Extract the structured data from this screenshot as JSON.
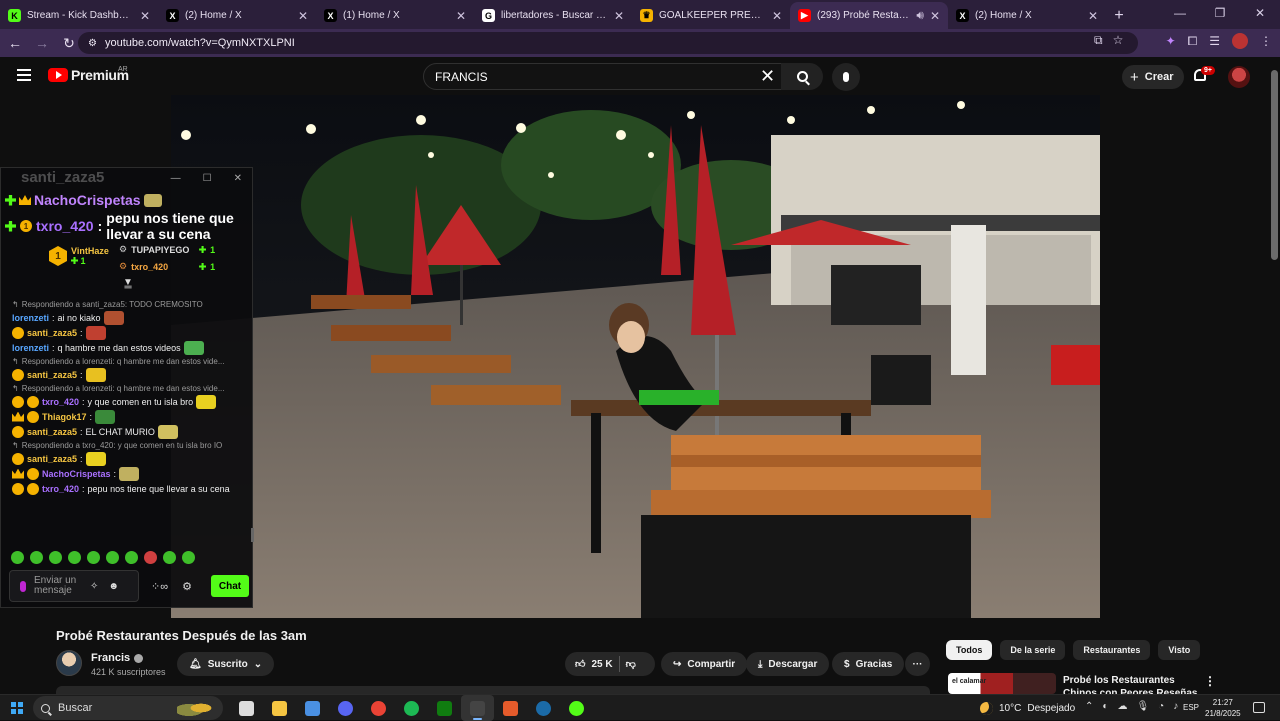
{
  "browser": {
    "tabs": [
      {
        "title": "Stream - Kick Dashboard",
        "favicon": "kick-icon",
        "color": "#53fc18",
        "glyph": "K",
        "active": false
      },
      {
        "title": "(2) Home / X",
        "favicon": "x-icon",
        "color": "#000000",
        "glyph": "X",
        "active": false
      },
      {
        "title": "(1) Home / X",
        "favicon": "x-icon",
        "color": "#000000",
        "glyph": "X",
        "active": false
      },
      {
        "title": "libertadores - Buscar con Google",
        "favicon": "google-icon",
        "color": "#ffffff",
        "glyph": "G",
        "active": false
      },
      {
        "title": "GOALKEEPER PREMIER free onl",
        "favicon": "crown-icon",
        "color": "#f5b200",
        "glyph": "♛",
        "active": false
      },
      {
        "title": "(293) Probé Restaurantes D",
        "favicon": "youtube-icon",
        "color": "#ff0000",
        "glyph": "▶",
        "active": true
      },
      {
        "title": "(2) Home / X",
        "favicon": "x-icon",
        "color": "#000000",
        "glyph": "X",
        "active": false
      }
    ],
    "url": "youtube.com/watch?v=QymNXTXLPNI"
  },
  "youtube": {
    "logo_text": "Premium",
    "region": "AR",
    "search_value": "FRANCIS",
    "create_label": "Crear",
    "notifications_badge": "9+"
  },
  "chat": {
    "ghost_name": "santi_zaza5",
    "pinned_top": {
      "name": "NachoCrispetas"
    },
    "pinned_main": {
      "badge": "1",
      "name": "txro_420",
      "separator": ":",
      "message": "pepu nos tiene que llevar a su cena"
    },
    "leaderboard": {
      "first": {
        "rank": "1",
        "name": "VintHaze",
        "count": "1"
      },
      "rows": [
        {
          "name": "TUPAPIYEGO",
          "count": "1"
        },
        {
          "name": "txro_420",
          "count": "1"
        }
      ]
    },
    "messages": [
      {
        "kind": "reply",
        "text": "Respondiendo a santi_zaza5: TODO CREMOSITO"
      },
      {
        "kind": "msg",
        "badges": [],
        "user": "lorenzeti",
        "color": "blue",
        "text": "ai no kiako",
        "emote": "#b05030"
      },
      {
        "kind": "msg",
        "badges": [
          "gold"
        ],
        "user": "santi_zaza5",
        "color": "gold",
        "text": "",
        "emote": "#c04030"
      },
      {
        "kind": "msg",
        "badges": [],
        "user": "lorenzeti",
        "color": "blue",
        "text": "q hambre me dan estos videos",
        "emote": "#4caf50"
      },
      {
        "kind": "reply",
        "text": "Respondiendo a lorenzeti: q hambre me dan estos vide..."
      },
      {
        "kind": "msg",
        "badges": [
          "gold"
        ],
        "user": "santi_zaza5",
        "color": "gold",
        "text": "",
        "emote": "#e8c020"
      },
      {
        "kind": "reply",
        "text": "Respondiendo a lorenzeti: q hambre me dan estos vide..."
      },
      {
        "kind": "msg",
        "badges": [
          "gold",
          "gold"
        ],
        "user": "txro_420",
        "color": "purple",
        "text": "y que comen en tu isla bro",
        "emote": "#e8d020"
      },
      {
        "kind": "msg",
        "badges": [
          "crown",
          "gold"
        ],
        "user": "Thiagok17",
        "color": "gold",
        "text": "",
        "emote": "#3a8a3a"
      },
      {
        "kind": "msg",
        "badges": [
          "gold"
        ],
        "user": "santi_zaza5",
        "color": "gold",
        "text": "EL CHAT MURIO",
        "emote": "#d0c060"
      },
      {
        "kind": "reply",
        "text": "Respondiendo a txro_420: y que comen en tu isla bro IO"
      },
      {
        "kind": "msg",
        "badges": [
          "gold"
        ],
        "user": "santi_zaza5",
        "color": "gold",
        "text": "",
        "emote": "#e8d020"
      },
      {
        "kind": "msg",
        "badges": [
          "crown",
          "gold"
        ],
        "user": "NachoCrispetas",
        "color": "purple",
        "text": "",
        "emote": "#c0b060"
      },
      {
        "kind": "msg",
        "badges": [
          "gold",
          "gold"
        ],
        "user": "txro_420",
        "color": "purple",
        "text": "pepu nos tiene que llevar a su cena",
        "emote": ""
      }
    ],
    "input_placeholder": "Enviar un mensaje",
    "send_label": "Chat"
  },
  "video_info": {
    "title": "Probé Restaurantes Después de las 3am",
    "channel": "Francis",
    "subscribers": "421 K suscriptores",
    "subscribe_label": "Suscrito",
    "likes": "25 K",
    "share_label": "Compartir",
    "download_label": "Descargar",
    "thanks_label": "Gracias"
  },
  "sidebar": {
    "chips": [
      {
        "label": "Todos",
        "active": true
      },
      {
        "label": "De la serie",
        "active": false
      },
      {
        "label": "Restaurantes",
        "active": false
      },
      {
        "label": "Visto",
        "active": false
      }
    ],
    "rec_thumb_text": "el calamar",
    "rec_title": "Probé los Restaurantes Chinos con Peores Reseñas"
  },
  "taskbar": {
    "search_placeholder": "Buscar",
    "apps": [
      {
        "name": "task-view-icon",
        "color": "#dddddd"
      },
      {
        "name": "file-explorer-icon",
        "color": "#f5c542"
      },
      {
        "name": "store-icon",
        "color": "#4a90e2"
      },
      {
        "name": "discord-icon",
        "color": "#5865f2"
      },
      {
        "name": "chrome-icon",
        "color": "#ea4335"
      },
      {
        "name": "spotify-icon",
        "color": "#1db954"
      },
      {
        "name": "xbox-icon",
        "color": "#107c10"
      },
      {
        "name": "obs-icon",
        "color": "#444444"
      },
      {
        "name": "browser-app-icon",
        "color": "#e55b2b"
      },
      {
        "name": "steam-icon",
        "color": "#1b6ba8"
      },
      {
        "name": "kick-app-icon",
        "color": "#53fc18"
      }
    ],
    "weather_temp": "10°C",
    "weather_desc": "Despejado",
    "language": "ESP",
    "time": "21:27",
    "date": "21/8/2025"
  }
}
